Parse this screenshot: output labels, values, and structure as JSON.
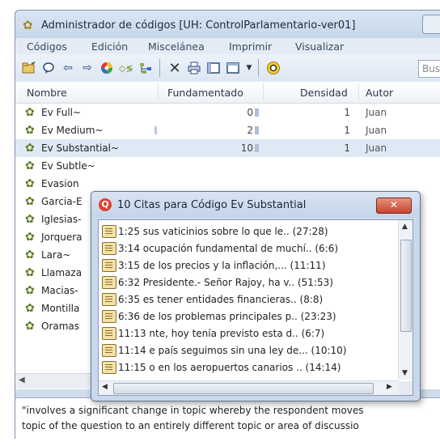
{
  "window": {
    "title": "Administrador de códigos [UH: ControlParlamentario-ver01]"
  },
  "menu": [
    "Códigos",
    "Edición",
    "Miscelánea",
    "Imprimir",
    "Visualizar"
  ],
  "toolbar": {
    "search_placeholder": "Busca",
    "icons": [
      "new-code-icon",
      "comment-icon",
      "back-icon",
      "forward-icon",
      "color-wheel-icon",
      "split-icon",
      "tree-icon",
      "delete-icon",
      "print-icon",
      "window-icon",
      "view-icon",
      "dropdown-icon",
      "search-icon"
    ]
  },
  "table": {
    "columns": [
      "Nombre",
      "Fundamentado",
      "Densidad",
      "Autor"
    ],
    "rows": [
      {
        "name": "Ev Full~",
        "fundamentado": "0",
        "densidad": "1",
        "autor": "Juan"
      },
      {
        "name": "Ev Medium~",
        "fundamentado": "2",
        "densidad": "1",
        "autor": "Juan"
      },
      {
        "name": "Ev Substantial~",
        "fundamentado": "10",
        "densidad": "1",
        "autor": "Juan"
      },
      {
        "name": "Ev Subtle~",
        "fundamentado": "",
        "densidad": "",
        "autor": ""
      },
      {
        "name": "Evasion",
        "fundamentado": "",
        "densidad": "",
        "autor": ""
      },
      {
        "name": "Garcia-E",
        "fundamentado": "",
        "densidad": "",
        "autor": ""
      },
      {
        "name": "Iglesias-",
        "fundamentado": "",
        "densidad": "",
        "autor": ""
      },
      {
        "name": "Jorquera",
        "fundamentado": "",
        "densidad": "",
        "autor": ""
      },
      {
        "name": "Lara~",
        "fundamentado": "",
        "densidad": "",
        "autor": ""
      },
      {
        "name": "Llamaza",
        "fundamentado": "",
        "densidad": "",
        "autor": ""
      },
      {
        "name": "Macias-",
        "fundamentado": "",
        "densidad": "",
        "autor": ""
      },
      {
        "name": "Montilla",
        "fundamentado": "",
        "densidad": "",
        "autor": ""
      },
      {
        "name": "Oramas",
        "fundamentado": "",
        "densidad": "",
        "autor": ""
      }
    ]
  },
  "comment": {
    "line1": "\"involves a significant change in topic whereby the respondent moves",
    "line2": "topic of the question to an entirely different topic or area of discussio"
  },
  "popup": {
    "title": "10 Citas para Código Ev Substantial",
    "close_label": "✕",
    "quotes": [
      "1:25 sus vaticinios sobre lo que le.. (27:28)",
      "3:14 ocupación fundamental de muchí.. (6:6)",
      "3:15 de los precios y la inflación,... (11:11)",
      "6:32 Presidente.- Señor Rajoy, ha v.. (51:53)",
      "6:35 es tener entidades financieras.. (8:8)",
      "6:36 de los problemas principales p.. (23:23)",
      "11:13 nte, hoy tenía previsto esta d.. (6:7)",
      "11:14 e país seguimos sin una ley de... (10:10)",
      "11:15 o en los aeropuertos canarios .. (14:14)"
    ]
  }
}
